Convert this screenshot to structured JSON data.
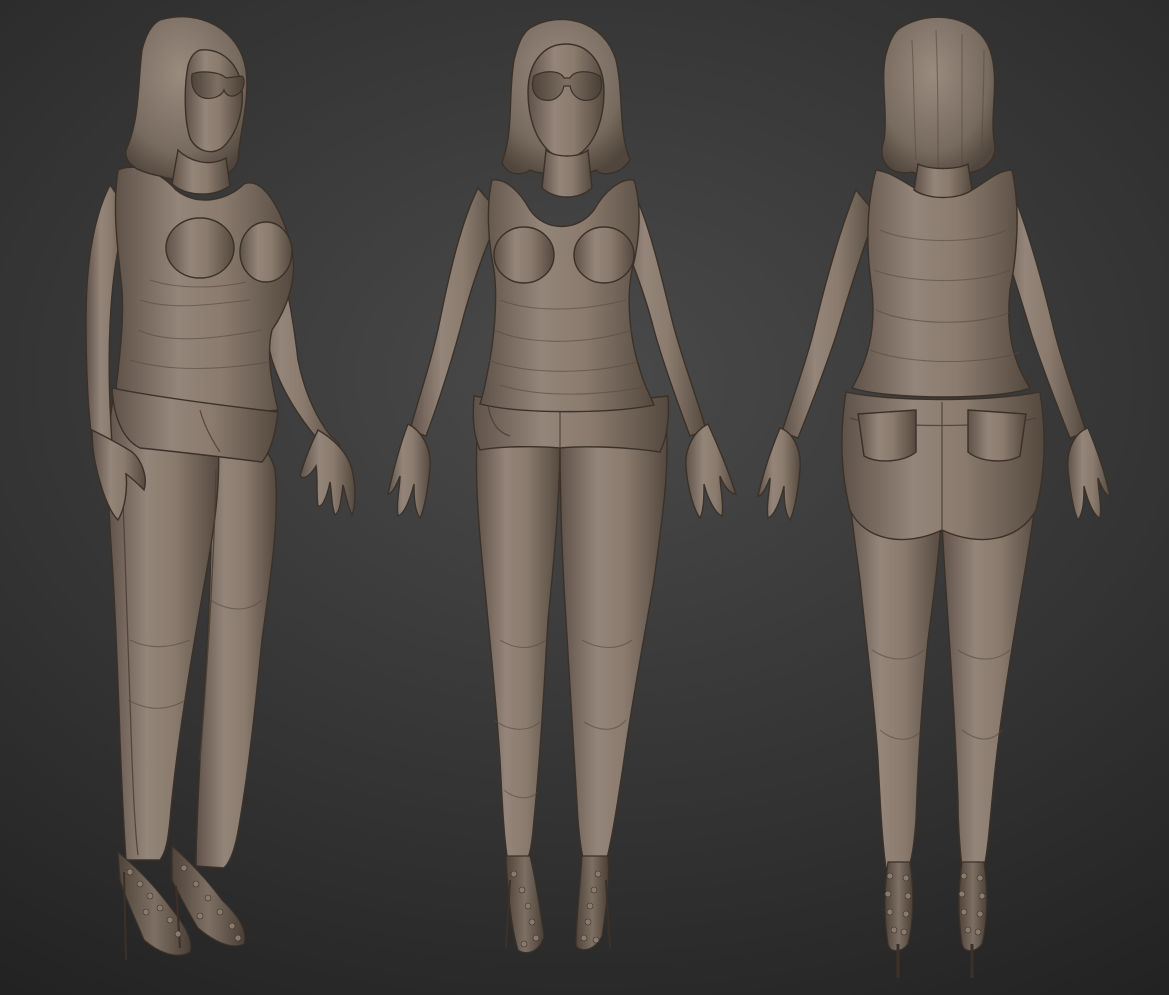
{
  "scene": {
    "background_color": "#2a2a2a",
    "clay_color": "#8b7b6d",
    "views": [
      {
        "id": "three-quarter",
        "name": "three-quarter-view"
      },
      {
        "id": "front",
        "name": "front-view"
      },
      {
        "id": "back",
        "name": "back-view"
      }
    ]
  }
}
